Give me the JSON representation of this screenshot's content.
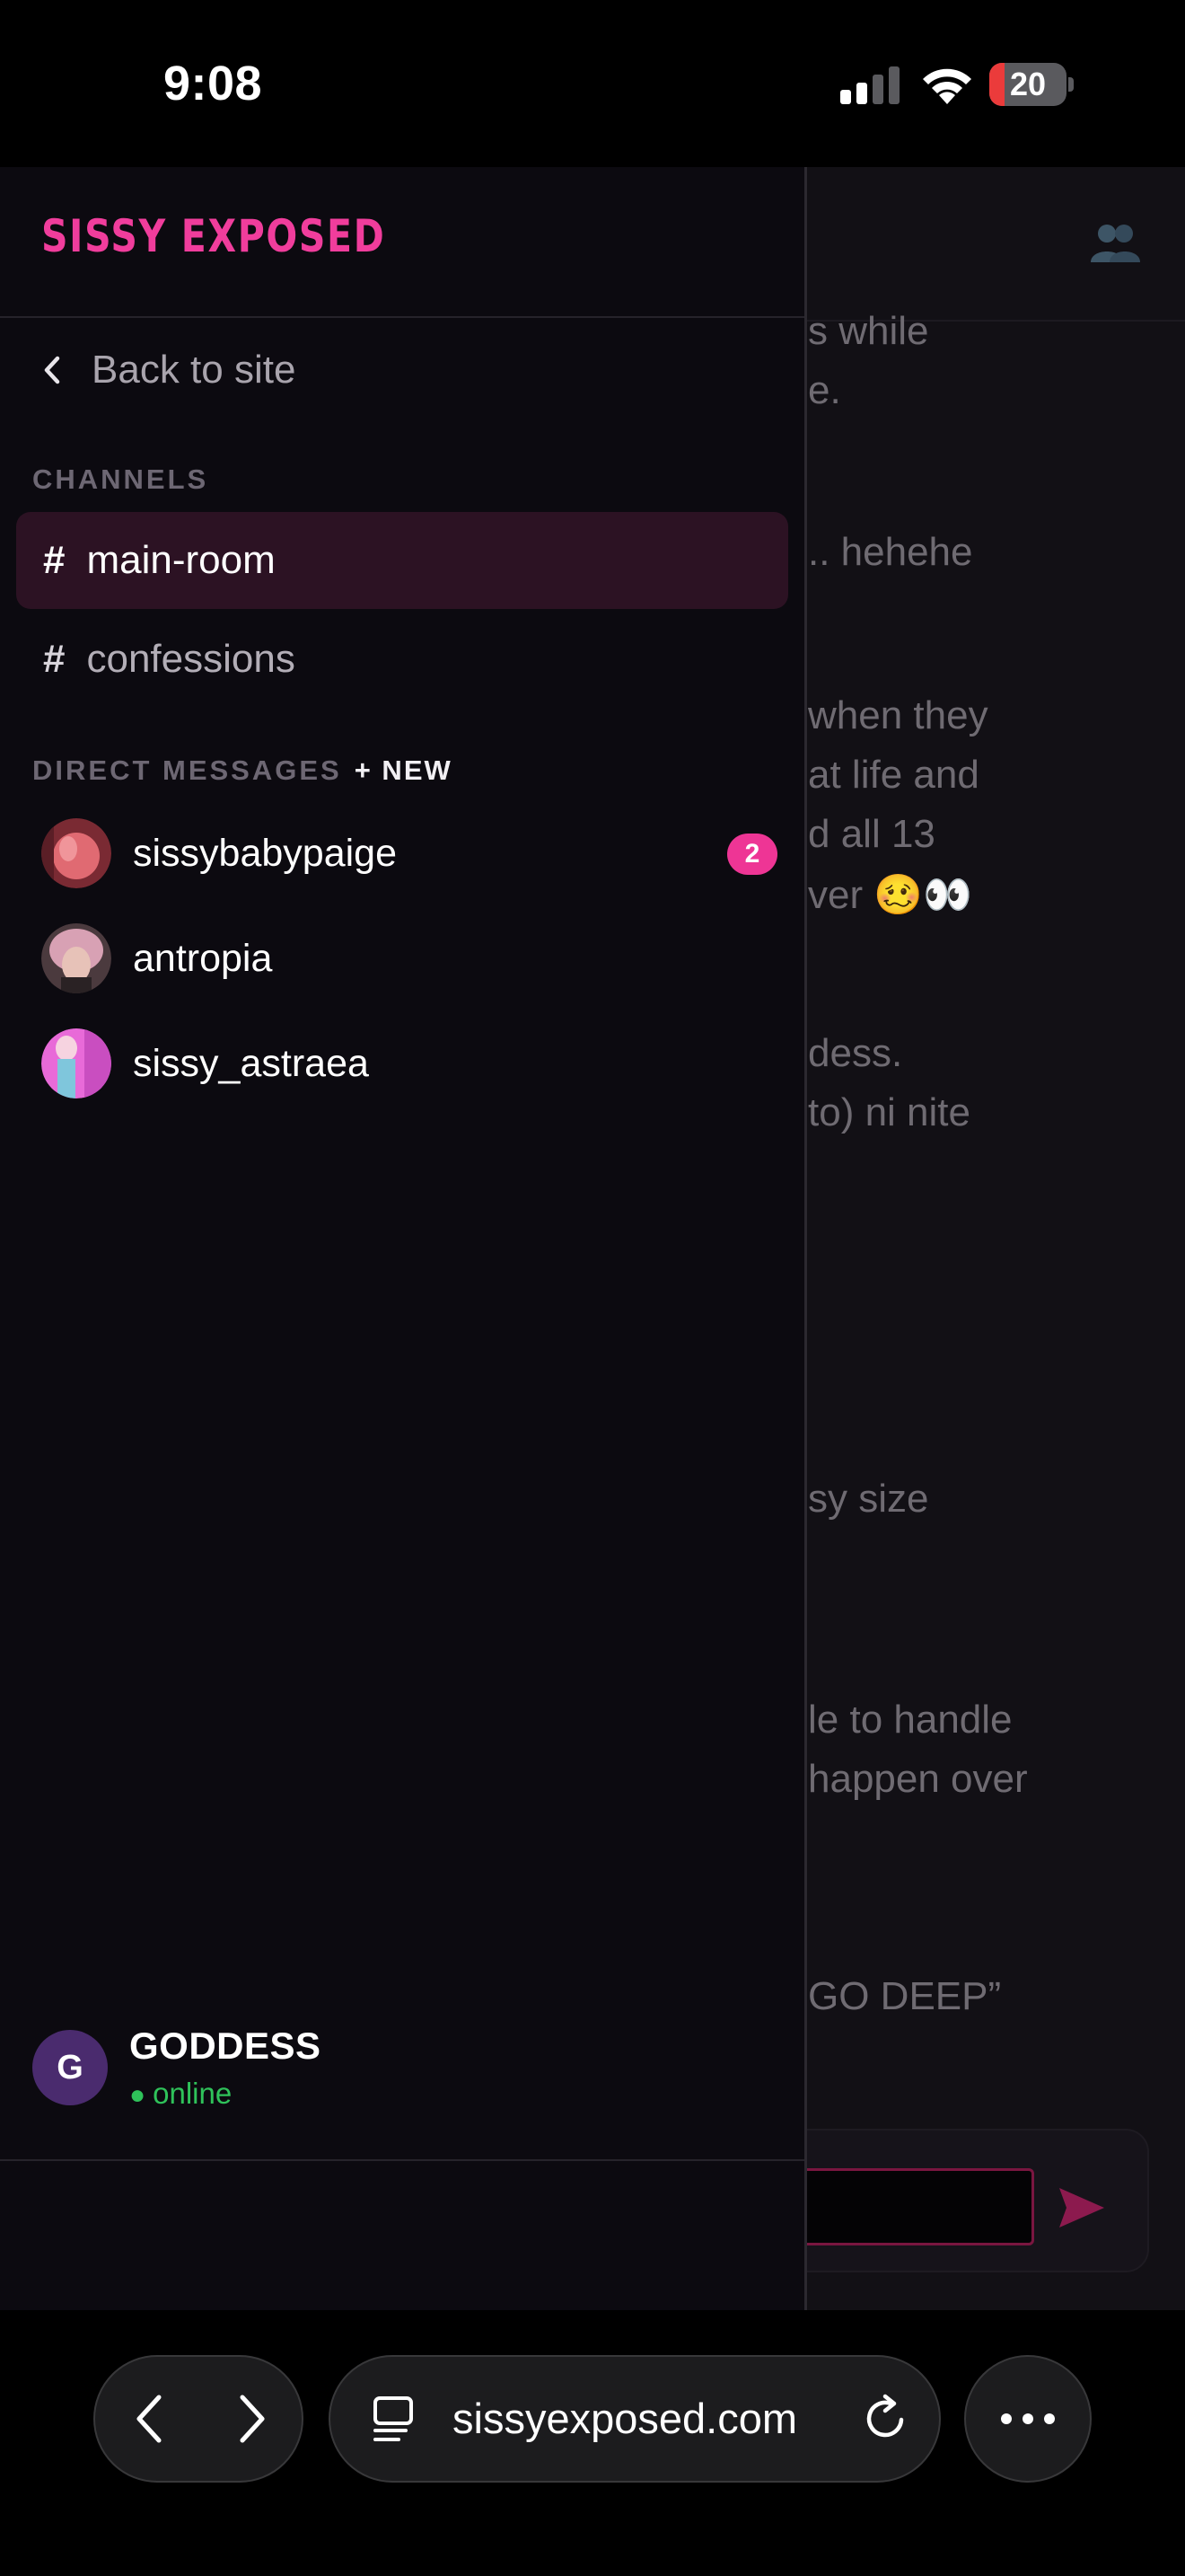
{
  "status_bar": {
    "time": "9:08",
    "battery_level": "20",
    "battery_fraction": 0.2,
    "battery_color": "#eb3b3b"
  },
  "background_page": {
    "header_icon": "group-icon",
    "message_fragments": [
      "s while",
      "e.",
      ".. hehehe",
      "when they",
      "at life and",
      "d all 13",
      "ver 🥴👀",
      "dess.",
      " to) ni nite",
      "sy size",
      "le to handle",
      " happen over",
      "GO DEEP”"
    ],
    "send_icon": "send-icon"
  },
  "drawer": {
    "brand": "SISSY EXPOSED",
    "brand_color": "#f03d9c",
    "back_label": "Back to site",
    "channels_heading": "CHANNELS",
    "channels": [
      {
        "hash": "#",
        "name": "main-room",
        "active": true
      },
      {
        "hash": "#",
        "name": "confessions",
        "active": false
      }
    ],
    "dm_heading": "DIRECT MESSAGES",
    "dm_new_label": "+ NEW",
    "direct_messages": [
      {
        "name": "sissybabypaige",
        "badge": "2"
      },
      {
        "name": "antropia",
        "badge": ""
      },
      {
        "name": "sissy_astraea",
        "badge": ""
      }
    ],
    "current_user": {
      "initial": "G",
      "name": "GODDESS",
      "status": "online",
      "status_color": "#2fc25a"
    }
  },
  "browser": {
    "url": "sissyexposed.com",
    "back_icon": "back-chevron-icon",
    "forward_icon": "forward-chevron-icon",
    "reload_icon": "reload-icon",
    "more_icon": "more-dots-icon"
  }
}
